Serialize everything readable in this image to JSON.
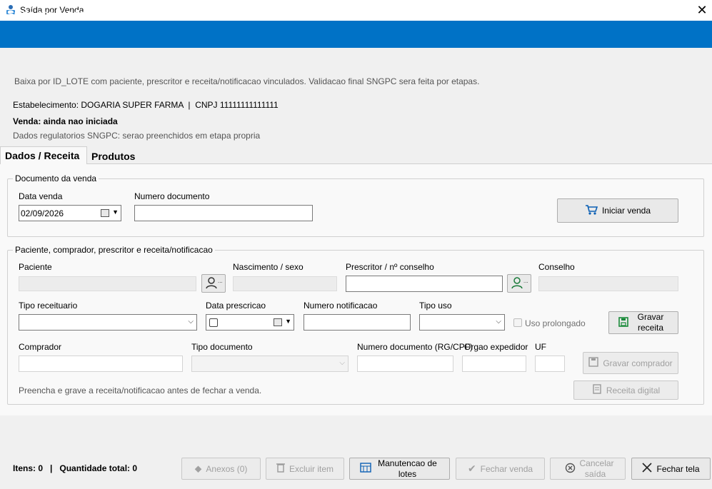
{
  "window": {
    "title": "Saída por Venda",
    "close": "✕"
  },
  "header": {
    "title": "Saída por Venda"
  },
  "info": {
    "description": "Baixa por ID_LOTE com paciente, prescritor e receita/notificacao vinculados. Validacao final SNGPC sera feita por etapas.",
    "establishment": "Estabelecimento: DOGARIA SUPER FARMA  |  CNPJ 11111111111111",
    "sale_status": "Venda: ainda nao iniciada",
    "regulatory": "Dados regulatorios SNGPC: serao preenchidos em etapa propria"
  },
  "tabs": [
    {
      "label": "Dados / Receita",
      "selected": true
    },
    {
      "label": "Produtos",
      "selected": false
    }
  ],
  "documento": {
    "group_title": "Documento da venda",
    "data_venda_label": "Data venda",
    "data_venda_value": "02/09/2026",
    "numero_documento_label": "Numero documento",
    "numero_documento_value": "",
    "iniciar_venda_label": "Iniciar venda"
  },
  "paciente": {
    "group_title": "Paciente, comprador, prescritor e receita/notificacao",
    "paciente_label": "Paciente",
    "nascimento_label": "Nascimento / sexo",
    "prescritor_label": "Prescritor / nº conselho",
    "conselho_label": "Conselho",
    "tipo_receituario_label": "Tipo receituario",
    "data_prescricao_label": "Data prescricao",
    "numero_notificacao_label": "Numero notificacao",
    "tipo_uso_label": "Tipo uso",
    "uso_prolongado_label": "Uso prolongado",
    "gravar_receita_label": "Gravar receita",
    "comprador_label": "Comprador",
    "tipo_documento_label": "Tipo documento",
    "numero_documento_rg_label": "Numero documento (RG/CPF)",
    "orgao_expedidor_label": "Orgao expedidor",
    "uf_label": "UF",
    "gravar_comprador_label": "Gravar comprador",
    "receita_digital_label": "Receita digital",
    "hint": "Preencha e grave a receita/notificacao antes de fechar a venda."
  },
  "footer": {
    "status": "Itens: 0   |   Quantidade total: 0",
    "anexos_label": "Anexos (0)",
    "excluir_item_label": "Excluir item",
    "manutencao_label": "Manutencao de lotes",
    "fechar_venda_label": "Fechar venda",
    "cancelar_saida_label": "Cancelar saída",
    "fechar_tela_label": "Fechar tela"
  },
  "colors": {
    "accent": "#0072c6",
    "background": "#f0f0f0",
    "panel": "#f9f9f9"
  }
}
